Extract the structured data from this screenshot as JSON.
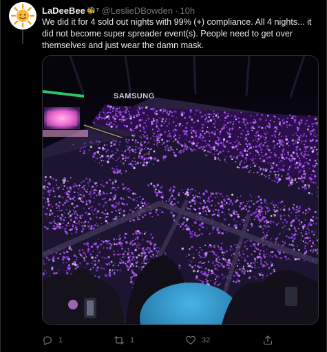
{
  "tweet": {
    "display_name": "LaDeeBee",
    "name_suffix": "🐝⁷",
    "handle": "@LeslieDBowden",
    "separator": "·",
    "timestamp": "10h",
    "text": "We did it for 4 sold out nights with 99% (+) compliance. All 4 nights... it did not become super spreader event(s). People need to get over themselves and just wear the damn mask.",
    "image": {
      "sign_text": "SAMSUNG"
    }
  },
  "actions": {
    "reply_count": "1",
    "retweet_count": "1",
    "like_count": "32",
    "share_count": ""
  },
  "colors": {
    "background": "#000000",
    "text": "#e7e9ea",
    "muted": "#71767b",
    "border": "#2f3336",
    "lightstick_purple": "#a94cff"
  },
  "icons": [
    "sun-avatar",
    "reply-icon",
    "retweet-icon",
    "like-icon",
    "share-icon"
  ]
}
